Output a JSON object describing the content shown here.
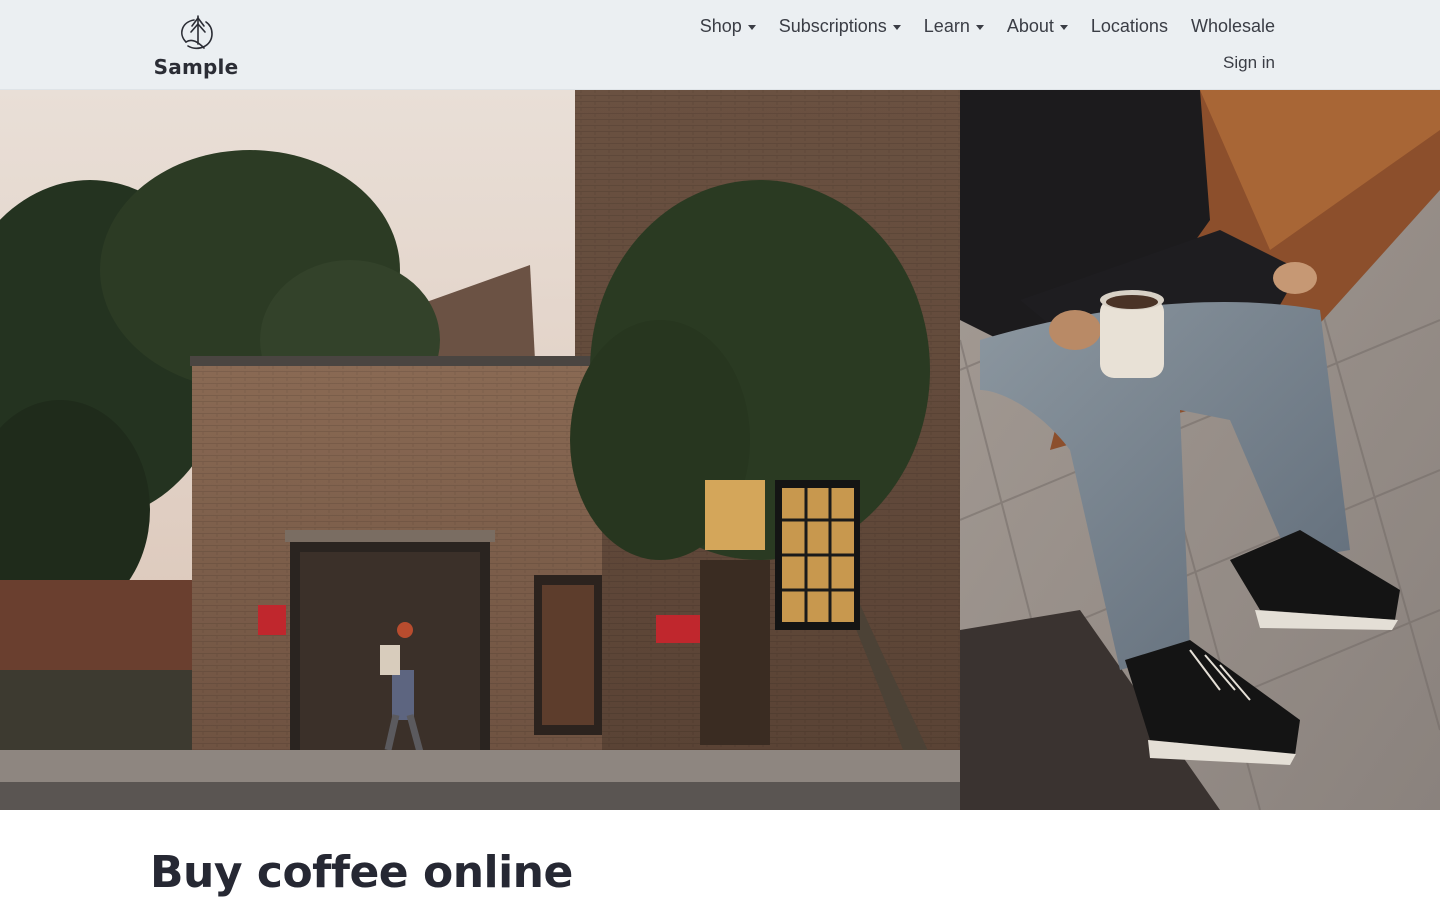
{
  "brand": {
    "name": "Sample",
    "logo_icon": "tree-leaf-logo-icon"
  },
  "nav": {
    "items": [
      {
        "label": "Shop",
        "dropdown": true
      },
      {
        "label": "Subscriptions",
        "dropdown": true
      },
      {
        "label": "Learn",
        "dropdown": true
      },
      {
        "label": "About",
        "dropdown": true
      },
      {
        "label": "Locations",
        "dropdown": false
      },
      {
        "label": "Wholesale",
        "dropdown": false
      }
    ],
    "sign_in": "Sign in"
  },
  "hero": {
    "left_image": "brick-roastery-building-street-photo",
    "right_image": "person-holding-coffee-cup-sitting-photo"
  },
  "main": {
    "title": "Buy coffee online"
  },
  "colors": {
    "header_bg": "#ebeff2",
    "text": "#2b2d35",
    "sign_red": "#c0272d"
  }
}
